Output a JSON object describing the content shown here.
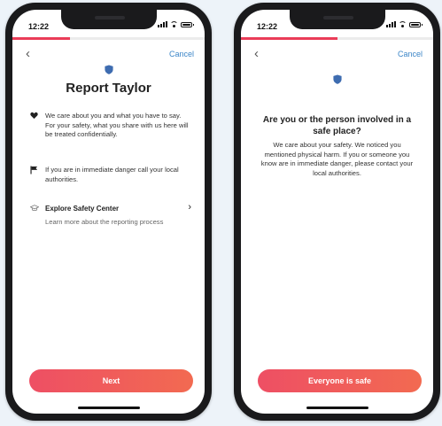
{
  "colors": {
    "accent": "#ea3c58",
    "link": "#3c86c8",
    "shield": "#3e6cb0"
  },
  "screen1": {
    "time": "12:22",
    "progress_fraction": 0.3,
    "cancel_label": "Cancel",
    "title": "Report Taylor",
    "items": [
      {
        "icon": "heart-icon",
        "text": "We care about you and what you have to say. For your safety, what you share with us here will be treated confidentially."
      },
      {
        "icon": "flag-icon",
        "text": "If you are in immediate danger call your local authorities."
      }
    ],
    "safety": {
      "icon": "graduation-cap-icon",
      "title": "Explore Safety Center",
      "subtitle": "Learn more about the reporting process"
    },
    "next_label": "Next"
  },
  "screen2": {
    "time": "12:22",
    "progress_fraction": 0.5,
    "cancel_label": "Cancel",
    "title": "Are you or the person involved in a safe place?",
    "body": "We care about your safety. We noticed you mentioned physical harm. If you or someone you know are in immediate danger, please contact your local authorities.",
    "cta_label": "Everyone is safe"
  }
}
